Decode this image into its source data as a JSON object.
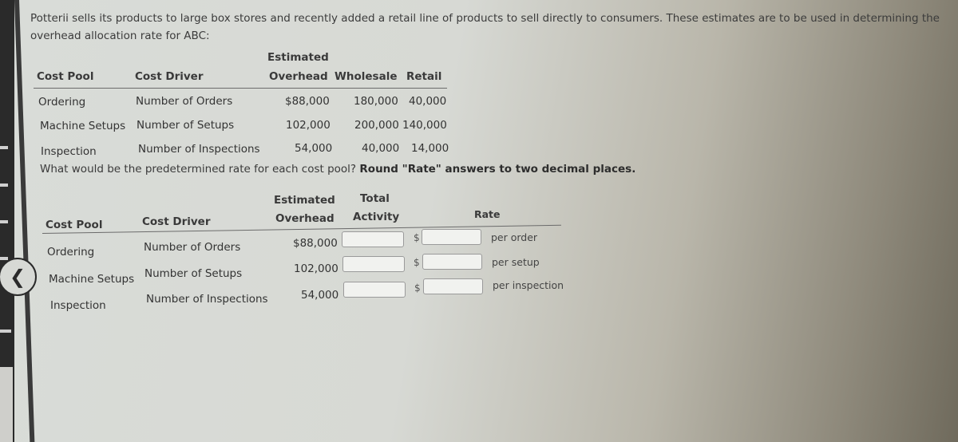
{
  "intro": "Potterii sells its products to large box stores and recently added a retail line of products to sell directly to consumers. These estimates are to be used in determining the overhead allocation rate for ABC:",
  "given_table": {
    "headers": {
      "cost_pool": "Cost Pool",
      "cost_driver": "Cost Driver",
      "estimated": "Estimated",
      "overhead": "Overhead",
      "wholesale": "Wholesale",
      "retail": "Retail"
    },
    "rows": [
      {
        "cost_pool": "Ordering",
        "cost_driver": "Number of Orders",
        "overhead": "$88,000",
        "wholesale": "180,000",
        "retail": "40,000"
      },
      {
        "cost_pool": "Machine Setups",
        "cost_driver": "Number of Setups",
        "overhead": "102,000",
        "wholesale": "200,000",
        "retail": "140,000"
      },
      {
        "cost_pool": "Inspection",
        "cost_driver": "Number of Inspections",
        "overhead": "54,000",
        "wholesale": "40,000",
        "retail": "14,000"
      }
    ]
  },
  "question": {
    "text": "What would be the predetermined rate for each cost pool?",
    "instruction": "Round \"Rate\" answers to two decimal places."
  },
  "answer_table": {
    "headers": {
      "cost_pool": "Cost Pool",
      "cost_driver": "Cost Driver",
      "estimated": "Estimated",
      "overhead": "Overhead",
      "total": "Total",
      "activity": "Activity",
      "rate": "Rate"
    },
    "currency_symbol": "$",
    "rows": [
      {
        "cost_pool": "Ordering",
        "cost_driver": "Number of Orders",
        "overhead": "$88,000",
        "total_activity": "",
        "rate": "",
        "unit": "per order"
      },
      {
        "cost_pool": "Machine Setups",
        "cost_driver": "Number of Setups",
        "overhead": "102,000",
        "total_activity": "",
        "rate": "",
        "unit": "per setup"
      },
      {
        "cost_pool": "Inspection",
        "cost_driver": "Number of Inspections",
        "overhead": "54,000",
        "total_activity": "",
        "rate": "",
        "unit": "per inspection"
      }
    ]
  },
  "nav": {
    "back_icon": "chevron-left-icon"
  }
}
